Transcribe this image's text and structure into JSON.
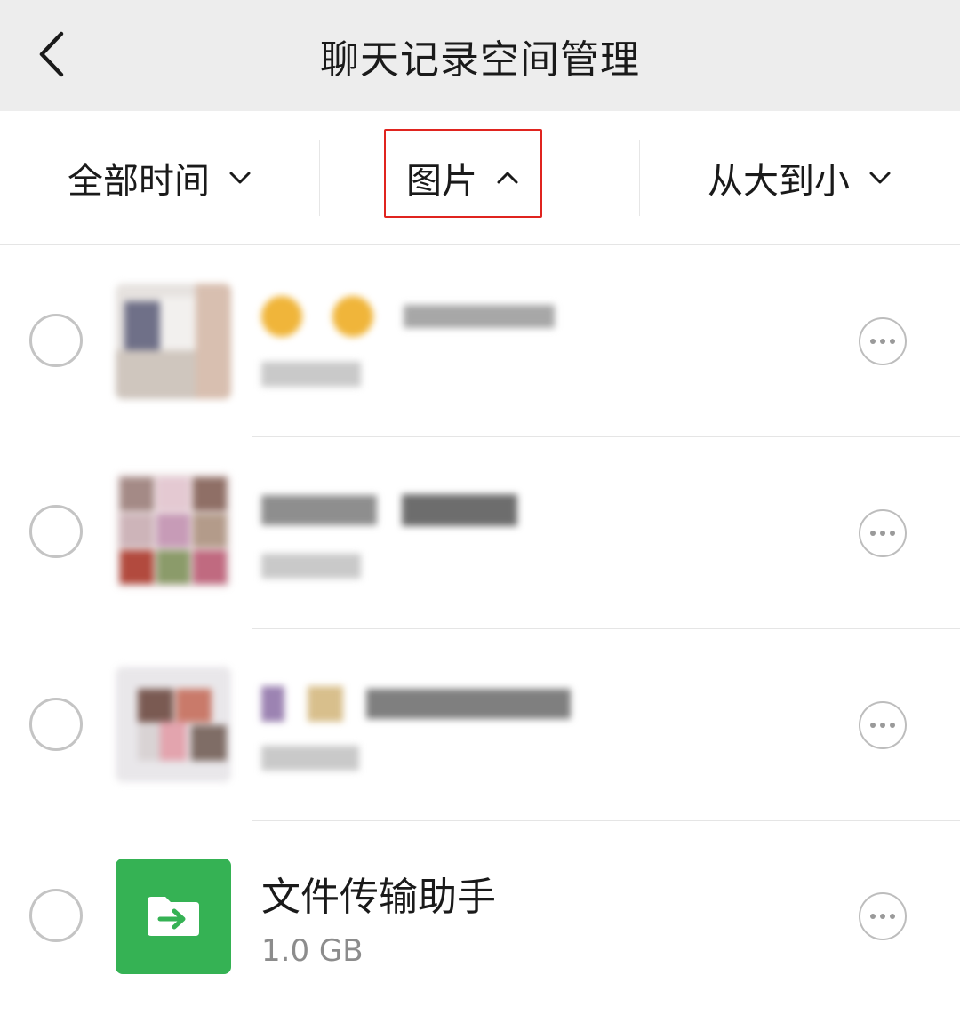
{
  "header": {
    "title": "聊天记录空间管理",
    "back_icon": "chevron-left-icon"
  },
  "filters": [
    {
      "label": "全部时间",
      "icon": "chevron-down-icon"
    },
    {
      "label": "图片",
      "icon": "chevron-up-icon",
      "highlighted": true
    },
    {
      "label": "从大到小",
      "icon": "chevron-down-icon"
    }
  ],
  "colors": {
    "highlight": "#e0241f",
    "file_transfer_green": "#35b254",
    "background": "#ededed"
  },
  "conversations": [
    {
      "name": "",
      "size": "",
      "blurred": true,
      "icon": "more-icon"
    },
    {
      "name": "",
      "size": "",
      "blurred": true,
      "icon": "more-icon"
    },
    {
      "name": "",
      "size": "",
      "blurred": true,
      "icon": "more-icon"
    },
    {
      "name": "文件传输助手",
      "size": "1.0 GB",
      "blurred": false,
      "icon": "more-icon",
      "avatar_icon": "folder-arrow-icon"
    }
  ]
}
